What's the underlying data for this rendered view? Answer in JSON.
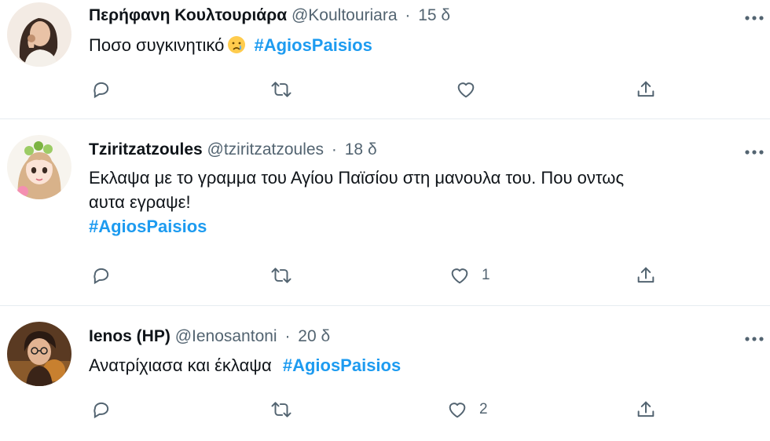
{
  "colors": {
    "accent": "#1d9bf0",
    "muted": "#536471",
    "text": "#0f1419",
    "divider": "#e6ecf0"
  },
  "tweets": [
    {
      "display_name": "Περήφανη Κουλτουριάρα",
      "handle": "@Koultouriara",
      "separator": "·",
      "time": "15 δ",
      "text": "Ποσο συγκινητικό",
      "emoji": "crying-face-emoji",
      "hashtag": "#AgiosPaisios",
      "reply_count": "",
      "retweet_count": "",
      "like_count": "",
      "share_count": ""
    },
    {
      "display_name": "Tziritzatzoules",
      "handle": "@tziritzatzoules",
      "separator": "·",
      "time": "18 δ",
      "text_line1": "Εκλαψα με το γραμμα του Αγίου Παϊσίου στη μανουλα του. Που οντως",
      "text_line2": "αυτα εγραψε!",
      "hashtag": "#AgiosPaisios",
      "reply_count": "",
      "retweet_count": "",
      "like_count": "1",
      "share_count": ""
    },
    {
      "display_name": "Ienos (HP)",
      "handle": "@Ienosantoni",
      "separator": "·",
      "time": "20 δ",
      "text": "Ανατρίχιασα και έκλαψα",
      "hashtag": "#AgiosPaisios",
      "reply_count": "",
      "retweet_count": "",
      "like_count": "2",
      "share_count": ""
    }
  ],
  "icons": {
    "reply": "reply-icon",
    "retweet": "retweet-icon",
    "like": "heart-icon",
    "share": "share-icon",
    "more": "more-icon"
  }
}
